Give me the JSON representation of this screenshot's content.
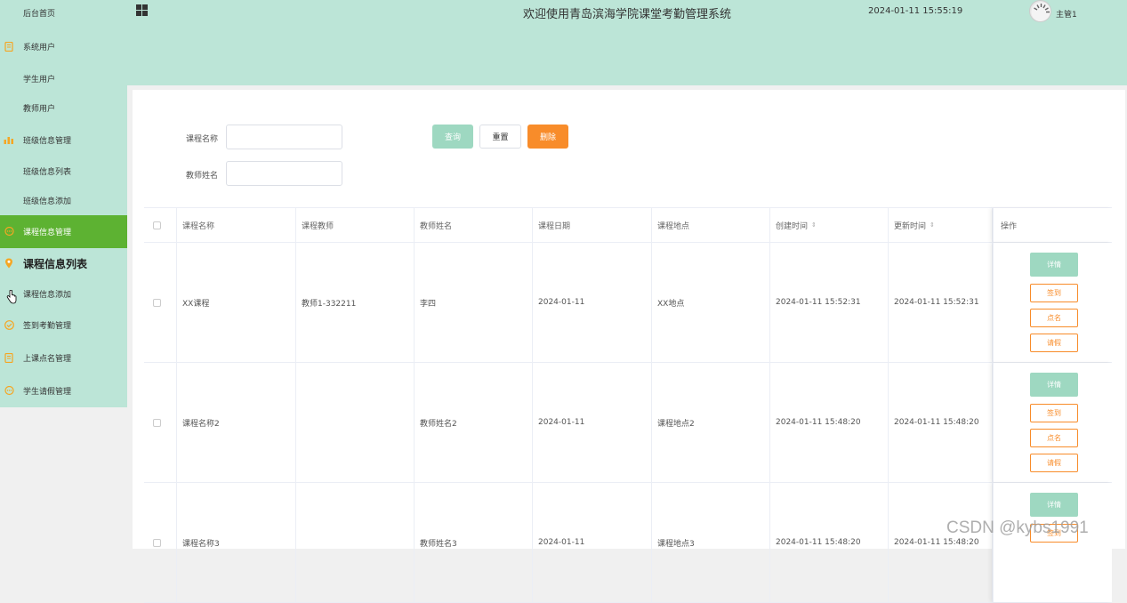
{
  "header": {
    "title": "欢迎使用青岛滨海学院课堂考勤管理系统",
    "datetime": "2024-01-11 15:55:19",
    "user": "主管1"
  },
  "sidebar": {
    "items": [
      {
        "label": "后台首页",
        "icon": ""
      },
      {
        "label": "系统用户",
        "icon": "document-icon"
      },
      {
        "label": "学生用户",
        "icon": ""
      },
      {
        "label": "教师用户",
        "icon": ""
      },
      {
        "label": "班级信息管理",
        "icon": "bar-chart-icon"
      },
      {
        "label": "班级信息列表",
        "icon": ""
      },
      {
        "label": "班级信息添加",
        "icon": ""
      },
      {
        "label": "课程信息管理",
        "icon": "chat-icon"
      },
      {
        "label": "课程信息列表",
        "icon": "location-pin-icon"
      },
      {
        "label": "课程信息添加",
        "icon": ""
      },
      {
        "label": "签到考勤管理",
        "icon": "check-circle-icon"
      },
      {
        "label": "上课点名管理",
        "icon": "document-icon"
      },
      {
        "label": "学生请假管理",
        "icon": "chat-icon"
      }
    ]
  },
  "search": {
    "course_label": "课程名称",
    "teacher_label": "教师姓名",
    "course_value": "",
    "teacher_value": "",
    "query_label": "查询",
    "reset_label": "重置",
    "delete_label": "删除"
  },
  "table": {
    "columns": [
      "课程名称",
      "课程教师",
      "教师姓名",
      "课程日期",
      "课程地点",
      "创建时间",
      "更新时间",
      "操作"
    ],
    "rows": [
      [
        "XX课程",
        "教师1-332211",
        "李四",
        "2024-01-11",
        "XX地点",
        "2024-01-11 15:52:31",
        "2024-01-11 15:52:31"
      ],
      [
        "课程名称2",
        "",
        "教师姓名2",
        "2024-01-11",
        "课程地点2",
        "2024-01-11 15:48:20",
        "2024-01-11 15:48:20"
      ],
      [
        "课程名称3",
        "",
        "教师姓名3",
        "2024-01-11",
        "课程地点3",
        "2024-01-11 15:48:20",
        "2024-01-11 15:48:20"
      ]
    ],
    "actions": {
      "detail": "详情",
      "signin": "签到",
      "rollcall": "点名",
      "leave": "请假"
    }
  },
  "watermark": "CSDN @kybs1991",
  "colors": {
    "theme": "#bce5d7",
    "active": "#5db232",
    "primary": "#9ed8c1",
    "danger": "#f88c2a",
    "icon": "#f5a623"
  }
}
